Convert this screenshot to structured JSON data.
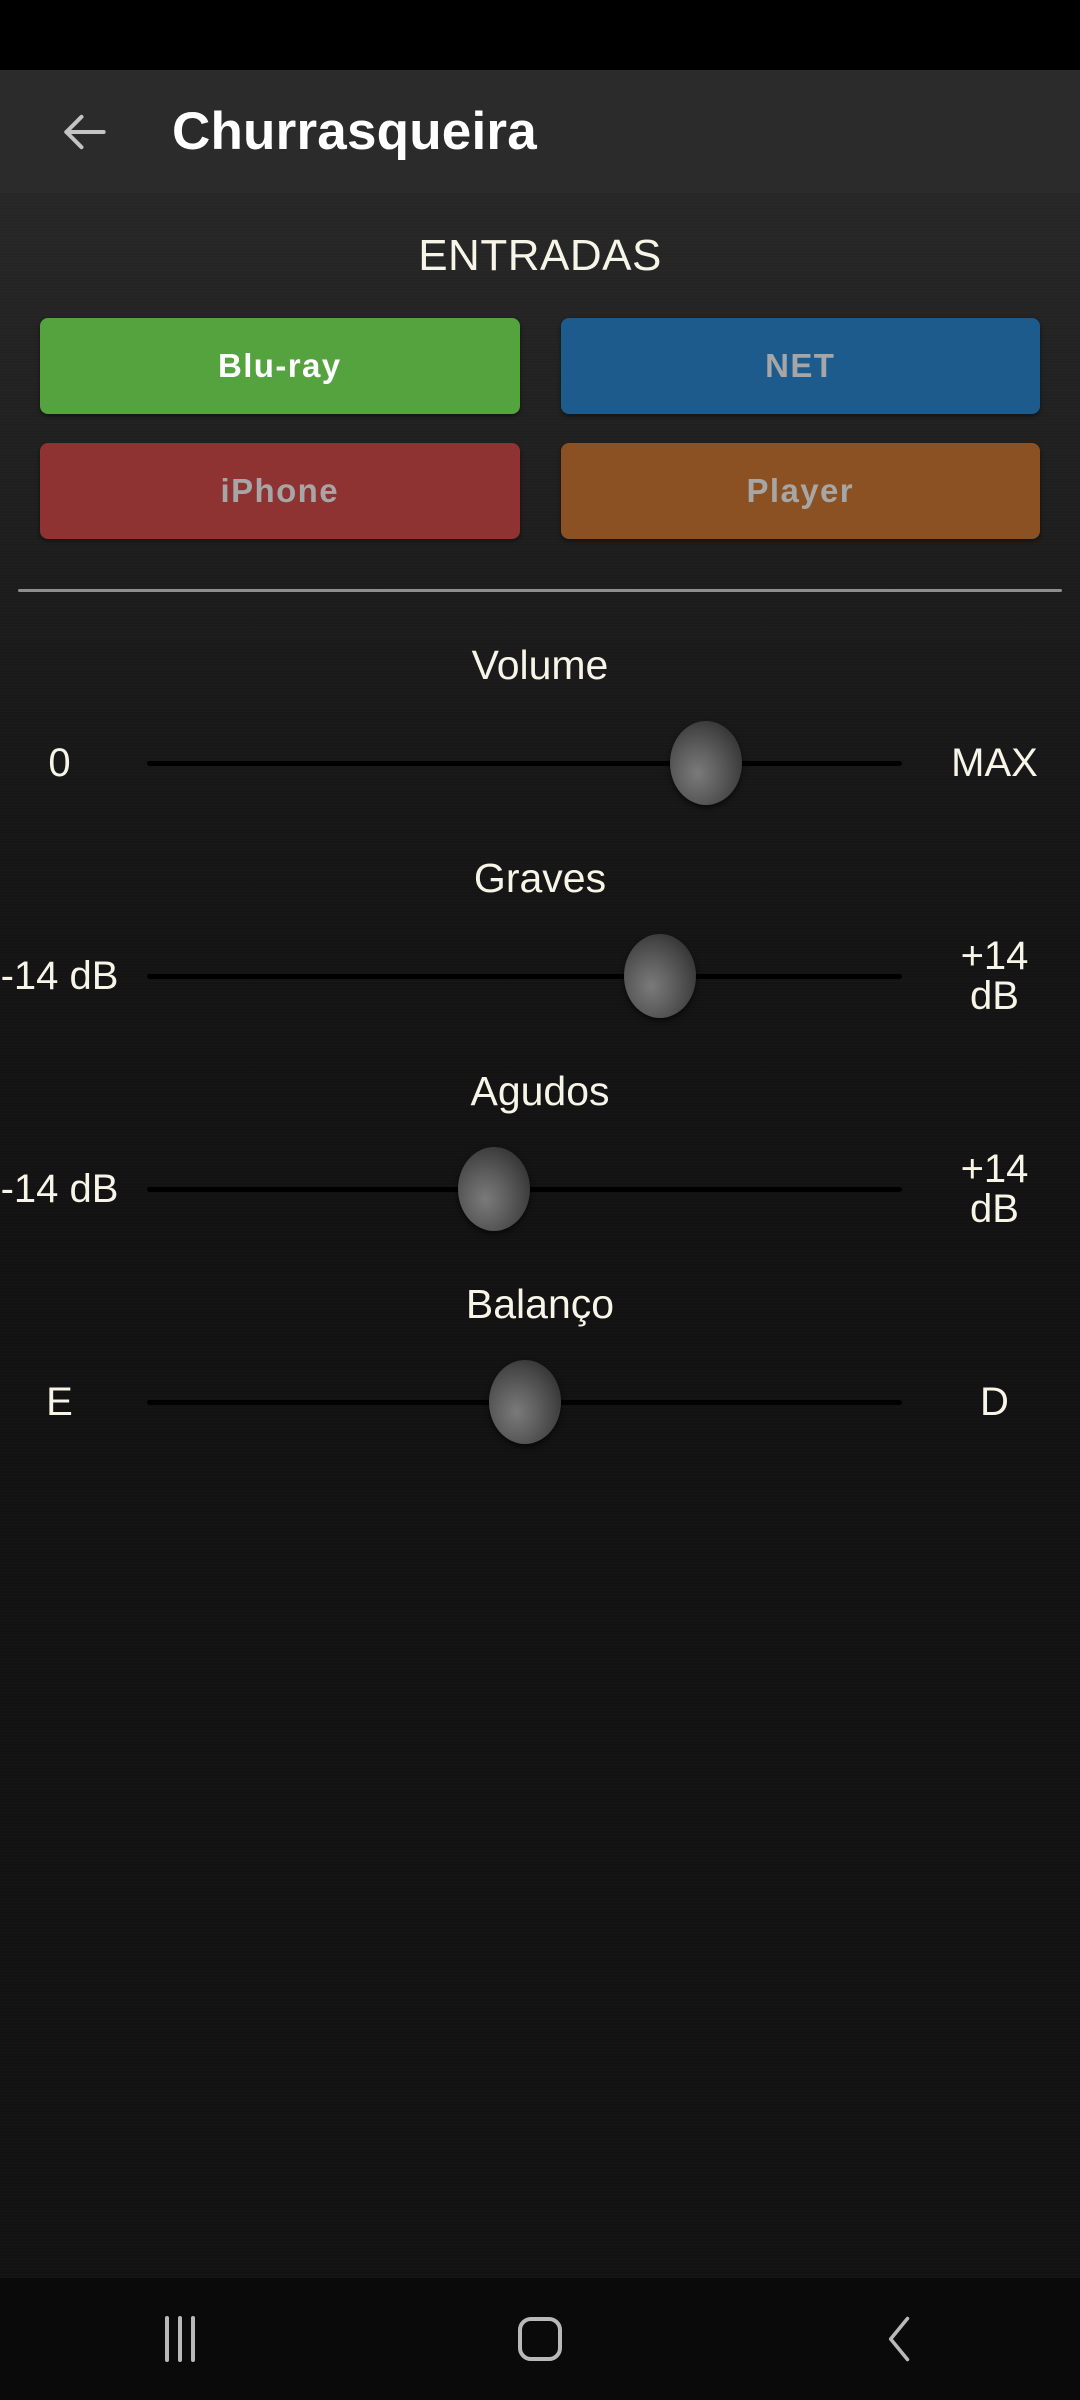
{
  "app_bar": {
    "back_icon": "arrow-left-icon",
    "title": "Churrasqueira"
  },
  "inputs_section": {
    "heading": "ENTRADAS",
    "buttons": [
      {
        "label": "Blu-ray",
        "color": "#55a33e",
        "selected": true
      },
      {
        "label": "NET",
        "color": "#1c5b8c",
        "selected": false
      },
      {
        "label": "iPhone",
        "color": "#8e3232",
        "selected": false
      },
      {
        "label": "Player",
        "color": "#8c5122",
        "selected": false
      }
    ]
  },
  "sliders": [
    {
      "name": "volume",
      "label": "Volume",
      "min_label": "0",
      "max_label": "MAX",
      "position_pct": 74
    },
    {
      "name": "graves",
      "label": "Graves",
      "min_label": "-14 dB",
      "max_label": "+14\ndB",
      "position_pct": 68
    },
    {
      "name": "agudos",
      "label": "Agudos",
      "min_label": "-14 dB",
      "max_label": "+14\ndB",
      "position_pct": 46
    },
    {
      "name": "balanco",
      "label": "Balanço",
      "min_label": "E",
      "max_label": "D",
      "position_pct": 50
    }
  ],
  "nav_bar": {
    "recents_icon": "recents-icon",
    "home_icon": "home-icon",
    "back_icon": "chevron-left-icon"
  }
}
